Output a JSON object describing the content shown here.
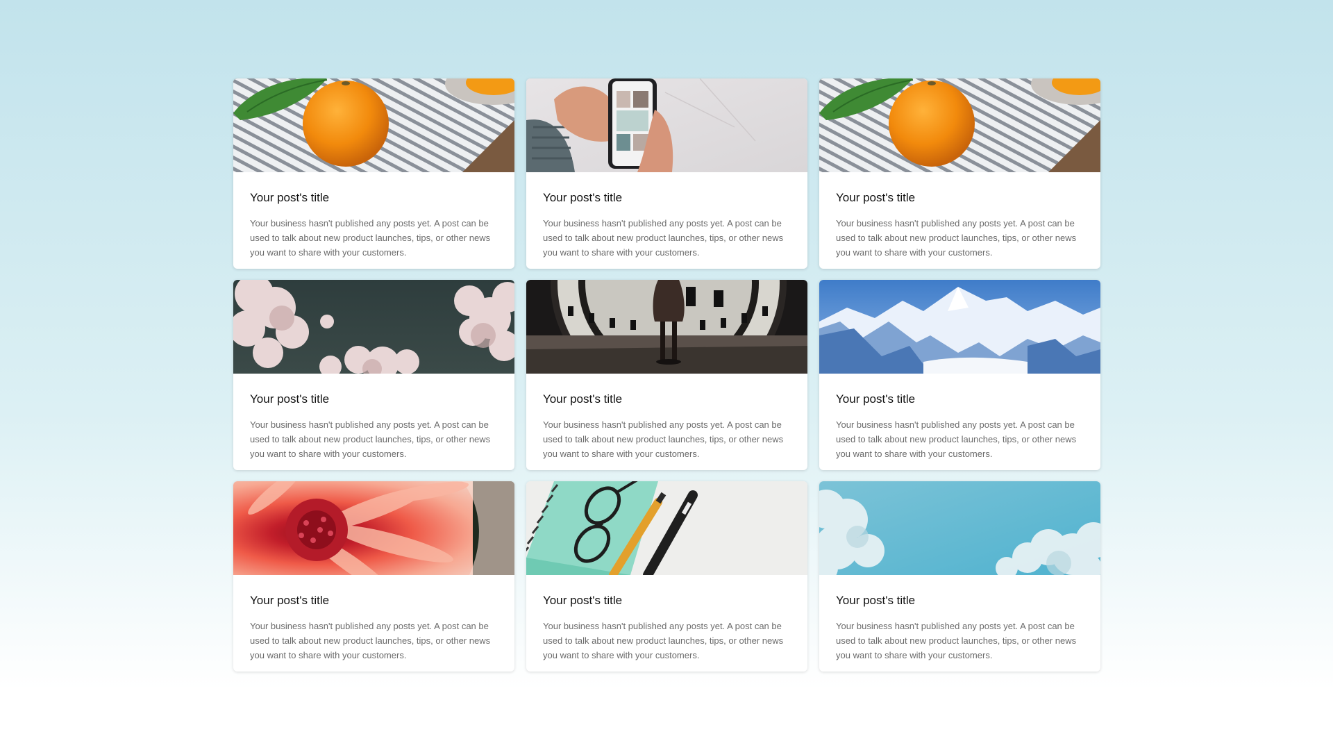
{
  "posts": [
    {
      "image": "orange-on-striped-towel",
      "title": "Your post's title",
      "description": "Your business hasn't published any posts yet. A post can be used to talk about new product launches, tips, or other news you want to share with your customers."
    },
    {
      "image": "hands-holding-phone",
      "title": "Your post's title",
      "description": "Your business hasn't published any posts yet. A post can be used to talk about new product launches, tips, or other news you want to share with your customers."
    },
    {
      "image": "orange-on-striped-towel",
      "title": "Your post's title",
      "description": "Your business hasn't published any posts yet. A post can be used to talk about new product launches, tips, or other news you want to share with your customers."
    },
    {
      "image": "pink-clouds-dark-sky",
      "title": "Your post's title",
      "description": "Your business hasn't published any posts yet. A post can be used to talk about new product launches, tips, or other news you want to share with your customers."
    },
    {
      "image": "person-before-clock-window",
      "title": "Your post's title",
      "description": "Your business hasn't published any posts yet. A post can be used to talk about new product launches, tips, or other news you want to share with your customers."
    },
    {
      "image": "snowy-mountains",
      "title": "Your post's title",
      "description": "Your business hasn't published any posts yet. A post can be used to talk about new product launches, tips, or other news you want to share with your customers."
    },
    {
      "image": "red-dahlia-flower",
      "title": "Your post's title",
      "description": "Your business hasn't published any posts yet. A post can be used to talk about new product launches, tips, or other news you want to share with your customers."
    },
    {
      "image": "notebook-glasses-pens",
      "title": "Your post's title",
      "description": "Your business hasn't published any posts yet. A post can be used to talk about new product launches, tips, or other news you want to share with your customers."
    },
    {
      "image": "blue-sky-clouds",
      "title": "Your post's title",
      "description": "Your business hasn't published any posts yet. A post can be used to talk about new product launches, tips, or other news you want to share with your customers."
    }
  ],
  "colors": {
    "background_top": "#c2e3ec",
    "background_bottom": "#ffffff",
    "card": "#ffffff",
    "title_text": "#111111",
    "description_text": "#6a6a6a"
  }
}
